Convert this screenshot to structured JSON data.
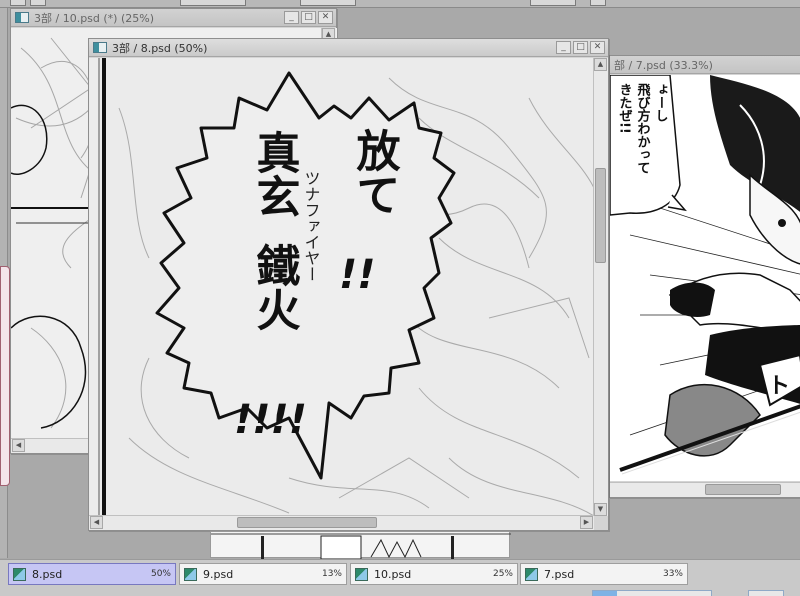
{
  "windows": {
    "doc10": {
      "title": "3部 / 10.psd (*) (25%)"
    },
    "doc8": {
      "title": "3部 / 8.psd (50%)",
      "speech": {
        "col1": "放て",
        "col1_bang": "!!",
        "col2": "真玄",
        "col3": "鐵火",
        "col3_bang": "!!!!",
        "ruby": "ツナファイヤー"
      }
    },
    "doc7": {
      "title": "部 / 7.psd (33.3%)",
      "bubble_lines": [
        "ょーし",
        "飛び方わかって",
        "きたぜ!!"
      ]
    }
  },
  "taskbar": {
    "tabs": [
      {
        "name": "8.psd",
        "zoom": "50%",
        "active": true
      },
      {
        "name": "9.psd",
        "zoom": "13%",
        "active": false
      },
      {
        "name": "10.psd",
        "zoom": "25%",
        "active": false
      },
      {
        "name": "7.psd",
        "zoom": "33%",
        "active": false
      }
    ],
    "progress": 0.2
  },
  "window_buttons": {
    "minimize": "_",
    "maximize": "□",
    "close": "✕"
  },
  "scroll_arrows": {
    "up": "▲",
    "down": "▼",
    "left": "◀",
    "right": "▶"
  },
  "icons": [
    "document-icon",
    "minimize-icon",
    "maximize-icon",
    "close-icon"
  ]
}
